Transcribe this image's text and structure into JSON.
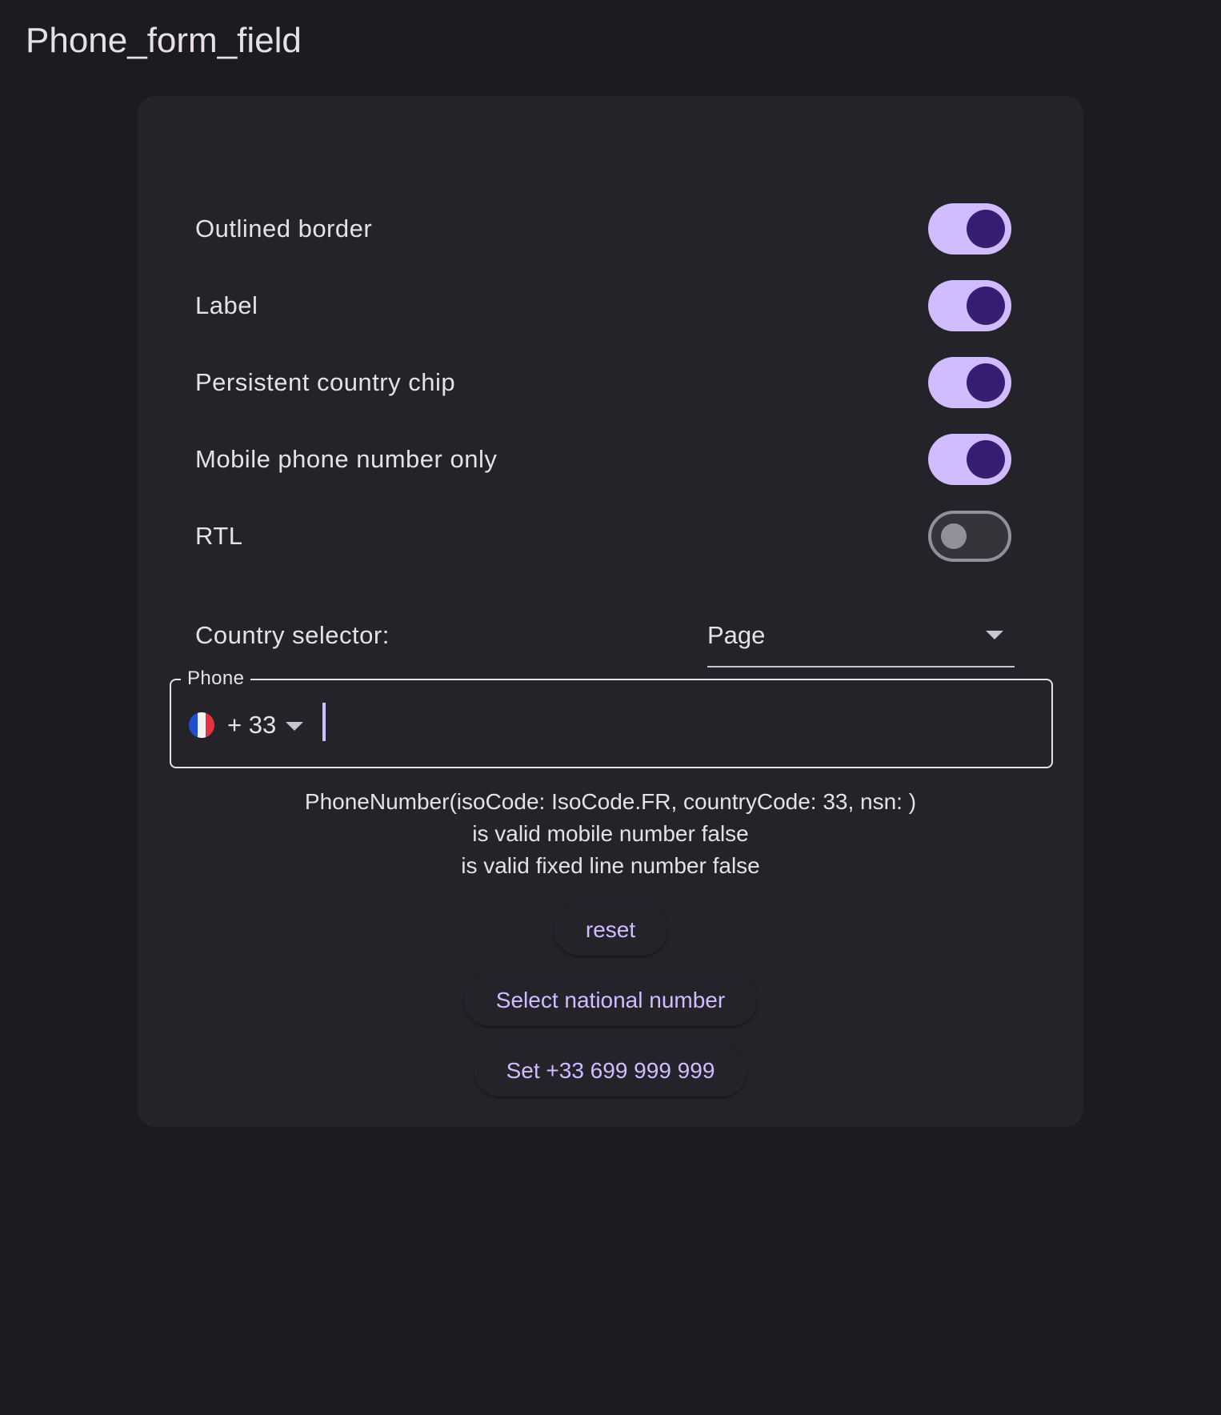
{
  "app": {
    "title": "Phone_form_field"
  },
  "settings": {
    "toggles": [
      {
        "label": "Outlined border",
        "on": true
      },
      {
        "label": "Label",
        "on": true
      },
      {
        "label": "Persistent country chip",
        "on": true
      },
      {
        "label": "Mobile phone number only",
        "on": true
      },
      {
        "label": "RTL",
        "on": false
      }
    ],
    "country_selector": {
      "label": "Country selector:",
      "value": "Page"
    }
  },
  "phone_field": {
    "label": "Phone",
    "country_flag": "france-flag",
    "dial_code": "+ 33",
    "value": ""
  },
  "info": {
    "line1": "PhoneNumber(isoCode: IsoCode.FR, countryCode: 33, nsn: )",
    "line2": "is valid mobile number false",
    "line3": "is valid fixed line number false"
  },
  "actions": {
    "reset": "reset",
    "select_national": "Select national number",
    "set_number": "Set +33 699 999 999"
  },
  "colors": {
    "background": "#1c1b20",
    "card": "#25232a",
    "accent": "#d0bcff",
    "switch_knob_on": "#381e72",
    "text": "#e6e1e6"
  }
}
